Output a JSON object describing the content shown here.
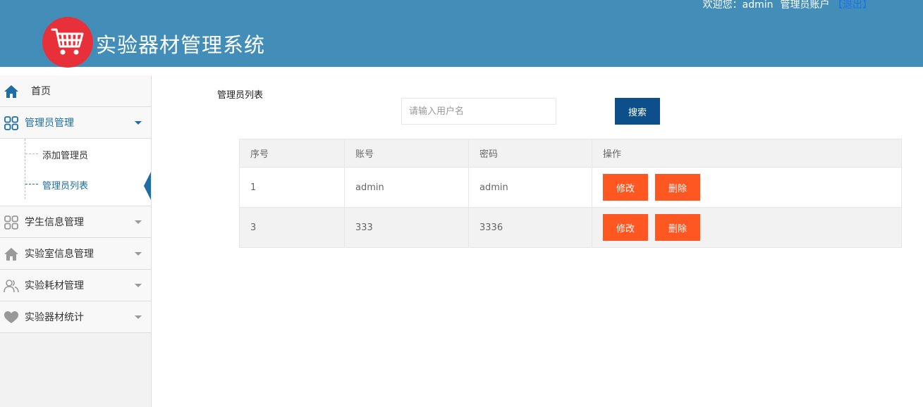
{
  "header": {
    "title": "实验器材管理系统",
    "welcome": "欢迎您：admin",
    "role": "管理员账户",
    "logout": "【退出】",
    "logo_color": "#e8303a",
    "bg_color": "#438eb9"
  },
  "sidebar": {
    "home": {
      "label": "首页",
      "icon": "home-icon"
    },
    "items": [
      {
        "label": "管理员管理",
        "icon": "grid-icon",
        "open": true,
        "children": [
          {
            "label": "添加管理员"
          },
          {
            "label": "管理员列表",
            "active": true
          }
        ]
      },
      {
        "label": "学生信息管理",
        "icon": "grid-icon"
      },
      {
        "label": "实验室信息管理",
        "icon": "home-outline-icon"
      },
      {
        "label": "实验耗材管理",
        "icon": "users-icon"
      },
      {
        "label": "实验器材统计",
        "icon": "heart-icon"
      }
    ]
  },
  "main": {
    "title": "管理员列表",
    "search": {
      "placeholder": "请输入用户名",
      "value": "",
      "button": "搜索"
    },
    "table": {
      "headers": [
        "序号",
        "账号",
        "密码",
        "操作"
      ],
      "rows": [
        {
          "id": "1",
          "account": "admin",
          "password": "admin"
        },
        {
          "id": "3",
          "account": "333",
          "password": "3336"
        }
      ],
      "edit_label": "修改",
      "delete_label": "删除"
    }
  }
}
